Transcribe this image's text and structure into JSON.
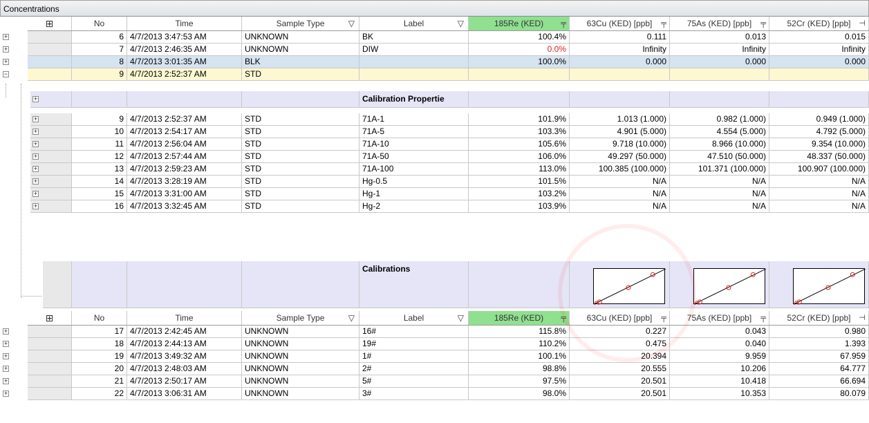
{
  "window": {
    "title": "Concentrations"
  },
  "columns": {
    "no": "No",
    "time": "Time",
    "sample_type": "Sample Type",
    "label": "Label",
    "re185": "185Re (KED)",
    "cu63": "63Cu (KED) [ppb]",
    "as75": "75As (KED) [ppb]",
    "cr52": "52Cr (KED) [ppb]"
  },
  "top_rows": [
    {
      "no": "6",
      "time": "4/7/2013  3:47:53 AM",
      "type": "UNKNOWN",
      "label": "BK",
      "re": "100.4%",
      "cu": "0.111",
      "as": "0.013",
      "cr": "0.015"
    },
    {
      "no": "7",
      "time": "4/7/2013  2:46:35 AM",
      "type": "UNKNOWN",
      "label": "DIW",
      "re": "0.0%",
      "cu": "Infinity",
      "as": "Infinity",
      "cr": "Infinity"
    },
    {
      "no": "8",
      "time": "4/7/2013  3:01:35 AM",
      "type": "BLK",
      "label": "",
      "re": "100.0%",
      "cu": "0.000",
      "as": "0.000",
      "cr": "0.000"
    },
    {
      "no": "9",
      "time": "4/7/2013  2:52:37 AM",
      "type": "STD",
      "label": "",
      "re": "",
      "cu": "",
      "as": "",
      "cr": ""
    }
  ],
  "calibration_properties_label": "Calibration Propertie",
  "std_rows": [
    {
      "no": "9",
      "time": "4/7/2013  2:52:37 AM",
      "type": "STD",
      "label": "71A-1",
      "re": "101.9%",
      "cu": "1.013 (1.000)",
      "as": "0.982 (1.000)",
      "cr": "0.949 (1.000)"
    },
    {
      "no": "10",
      "time": "4/7/2013  2:54:17 AM",
      "type": "STD",
      "label": "71A-5",
      "re": "103.3%",
      "cu": "4.901 (5.000)",
      "as": "4.554 (5.000)",
      "cr": "4.792 (5.000)"
    },
    {
      "no": "11",
      "time": "4/7/2013  2:56:04 AM",
      "type": "STD",
      "label": "71A-10",
      "re": "105.6%",
      "cu": "9.718 (10.000)",
      "as": "8.966 (10.000)",
      "cr": "9.354 (10.000)"
    },
    {
      "no": "12",
      "time": "4/7/2013  2:57:44 AM",
      "type": "STD",
      "label": "71A-50",
      "re": "106.0%",
      "cu": "49.297 (50.000)",
      "as": "47.510 (50.000)",
      "cr": "48.337 (50.000)"
    },
    {
      "no": "13",
      "time": "4/7/2013  2:59:23 AM",
      "type": "STD",
      "label": "71A-100",
      "re": "113.0%",
      "cu": "100.385 (100.000)",
      "as": "101.371 (100.000)",
      "cr": "100.907 (100.000)"
    },
    {
      "no": "14",
      "time": "4/7/2013  3:28:19 AM",
      "type": "STD",
      "label": "Hg-0.5",
      "re": "101.5%",
      "cu": "N/A",
      "as": "N/A",
      "cr": "N/A"
    },
    {
      "no": "15",
      "time": "4/7/2013  3:31:00 AM",
      "type": "STD",
      "label": "Hg-1",
      "re": "103.2%",
      "cu": "N/A",
      "as": "N/A",
      "cr": "N/A"
    },
    {
      "no": "16",
      "time": "4/7/2013  3:32:45 AM",
      "type": "STD",
      "label": "Hg-2",
      "re": "103.9%",
      "cu": "N/A",
      "as": "N/A",
      "cr": "N/A"
    }
  ],
  "calibrations_label": "Calibrations",
  "bottom_rows": [
    {
      "no": "17",
      "time": "4/7/2013  2:42:45 AM",
      "type": "UNKNOWN",
      "label": "16#",
      "re": "115.8%",
      "cu": "0.227",
      "as": "0.043",
      "cr": "0.980"
    },
    {
      "no": "18",
      "time": "4/7/2013  2:44:13 AM",
      "type": "UNKNOWN",
      "label": "19#",
      "re": "110.2%",
      "cu": "0.475",
      "as": "0.040",
      "cr": "1.393"
    },
    {
      "no": "19",
      "time": "4/7/2013  3:49:32 AM",
      "type": "UNKNOWN",
      "label": "1#",
      "re": "100.1%",
      "cu": "20.394",
      "as": "9.959",
      "cr": "67.959"
    },
    {
      "no": "20",
      "time": "4/7/2013  2:48:03 AM",
      "type": "UNKNOWN",
      "label": "2#",
      "re": "98.8%",
      "cu": "20.555",
      "as": "10.206",
      "cr": "64.777"
    },
    {
      "no": "21",
      "time": "4/7/2013  2:50:17 AM",
      "type": "UNKNOWN",
      "label": "5#",
      "re": "97.5%",
      "cu": "20.501",
      "as": "10.418",
      "cr": "66.694"
    },
    {
      "no": "22",
      "time": "4/7/2013  3:06:31 AM",
      "type": "UNKNOWN",
      "label": "3#",
      "re": "98.0%",
      "cu": "20.501",
      "as": "10.353",
      "cr": "80.079"
    }
  ],
  "colors": {
    "header_highlight": "#8fe08f",
    "selected_row": "#d6e3f0",
    "editing_row": "#fdf8d1",
    "band": "#e5e5f7",
    "error_text": "#e02020"
  }
}
